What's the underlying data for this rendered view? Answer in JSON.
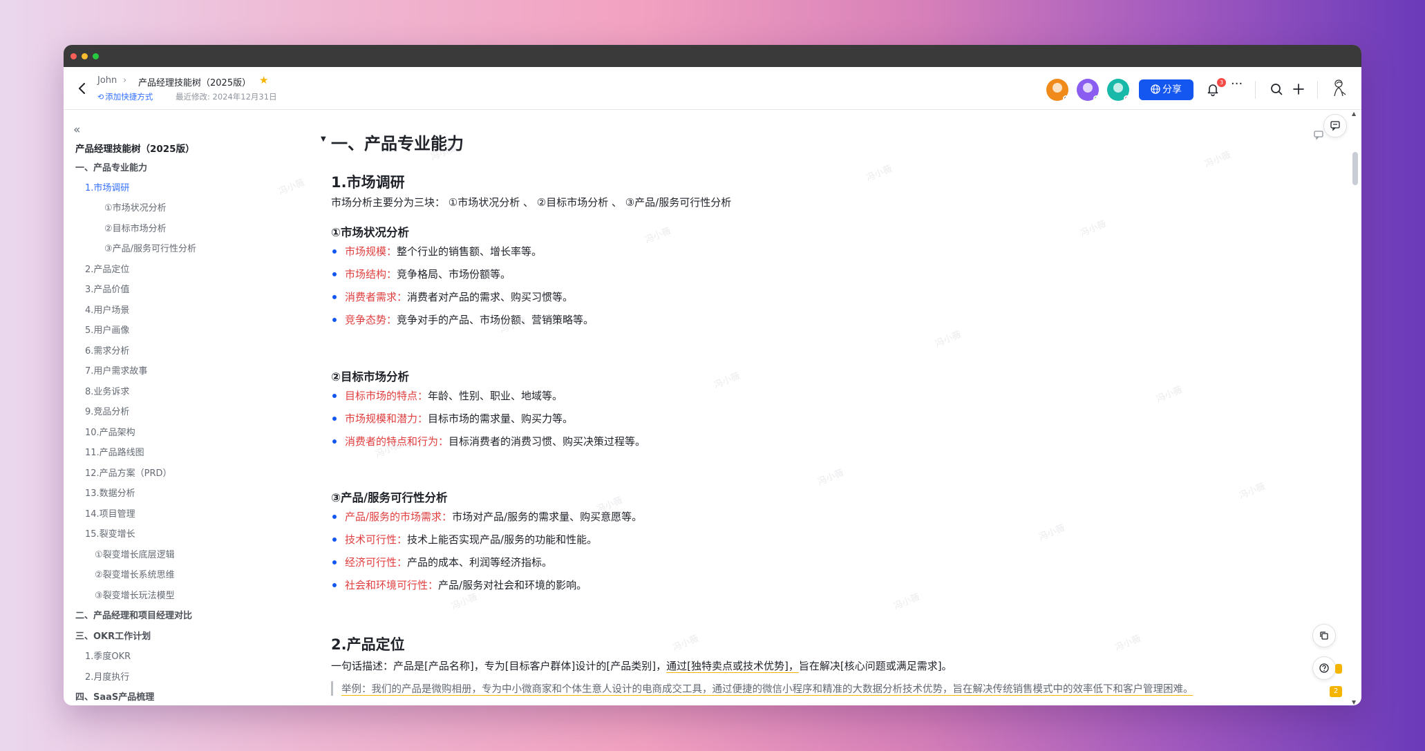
{
  "header": {
    "owner": "John",
    "breadcrumb_sep": "›",
    "doc_title": "产品经理技能树（2025版）",
    "add_shortcut": "添加快捷方式",
    "last_edit": "最近修改: 2024年12月31日",
    "share_label": "分享",
    "notification_count": "3",
    "more_label": "···"
  },
  "sidebar": {
    "items": [
      {
        "label": "产品经理技能树（2025版）"
      },
      {
        "label": "一、产品专业能力"
      },
      {
        "label": "1.市场调研"
      },
      {
        "label": "①市场状况分析"
      },
      {
        "label": "②目标市场分析"
      },
      {
        "label": "③产品/服务可行性分析"
      },
      {
        "label": "2.产品定位"
      },
      {
        "label": "3.产品价值"
      },
      {
        "label": "4.用户场景"
      },
      {
        "label": "5.用户画像"
      },
      {
        "label": "6.需求分析"
      },
      {
        "label": "7.用户需求故事"
      },
      {
        "label": "8.业务诉求"
      },
      {
        "label": "9.竞品分析"
      },
      {
        "label": "10.产品架构"
      },
      {
        "label": "11.产品路线图"
      },
      {
        "label": "12.产品方案（PRD）"
      },
      {
        "label": "13.数据分析"
      },
      {
        "label": "14.项目管理"
      },
      {
        "label": "15.裂变增长"
      },
      {
        "label": "①裂变增长底层逻辑"
      },
      {
        "label": "②裂变增长系统思维"
      },
      {
        "label": "③裂变增长玩法模型"
      },
      {
        "label": "二、产品经理和项目经理对比"
      },
      {
        "label": "三、OKR工作计划"
      },
      {
        "label": "1.季度OKR"
      },
      {
        "label": "2.月度执行"
      },
      {
        "label": "四、SaaS产品梳理"
      }
    ]
  },
  "content": {
    "h1": "一、产品专业能力",
    "s1_title": "1.市场调研",
    "s1_intro": "市场分析主要分为三块： ①市场状况分析 、 ②目标市场分析 、 ③产品/服务可行性分析",
    "a_title": "①市场状况分析",
    "a_items": [
      {
        "term": "市场规模：",
        "desc": "整个行业的销售额、增长率等。"
      },
      {
        "term": "市场结构：",
        "desc": "竞争格局、市场份额等。"
      },
      {
        "term": "消费者需求：",
        "desc": "消费者对产品的需求、购买习惯等。"
      },
      {
        "term": "竞争态势：",
        "desc": "竞争对手的产品、市场份额、营销策略等。"
      }
    ],
    "b_title": "②目标市场分析",
    "b_items": [
      {
        "term": "目标市场的特点：",
        "desc": "年龄、性别、职业、地域等。"
      },
      {
        "term": "市场规模和潜力：",
        "desc": "目标市场的需求量、购买力等。"
      },
      {
        "term": "消费者的特点和行为：",
        "desc": "目标消费者的消费习惯、购买决策过程等。"
      }
    ],
    "c_title": "③产品/服务可行性分析",
    "c_items": [
      {
        "term": "产品/服务的市场需求：",
        "desc": "市场对产品/服务的需求量、购买意愿等。"
      },
      {
        "term": "技术可行性：",
        "desc": "技术上能否实现产品/服务的功能和性能。"
      },
      {
        "term": "经济可行性：",
        "desc": "产品的成本、利润等经济指标。"
      },
      {
        "term": "社会和环境可行性：",
        "desc": "产品/服务对社会和环境的影响。"
      }
    ],
    "s2_title": "2.产品定位",
    "s2_line_pre": "一句话描述：产品是[产品名称]，专为[目标客户群体]设计的[产品类别]，",
    "s2_line_hl": "通过[独特卖点或技术优势]，",
    "s2_line_post": "旨在解决[核心问题或满足需求]。",
    "s2_example": "举例：我们的产品是微购相册，专为中小微商家和个体生意人设计的电商成交工具，通过便捷的微信小程序和精准的大数据分析技术优势，旨在解决传统销售模式中的效率低下和客户管理困难。"
  },
  "floating": {
    "badge_count": "2"
  },
  "watermark_text": "冯小薇",
  "colors": {
    "accent": "#1456f0",
    "term_red": "#e03e3e",
    "active_link": "#3370ff",
    "highlight_underline": "#f5b400"
  }
}
